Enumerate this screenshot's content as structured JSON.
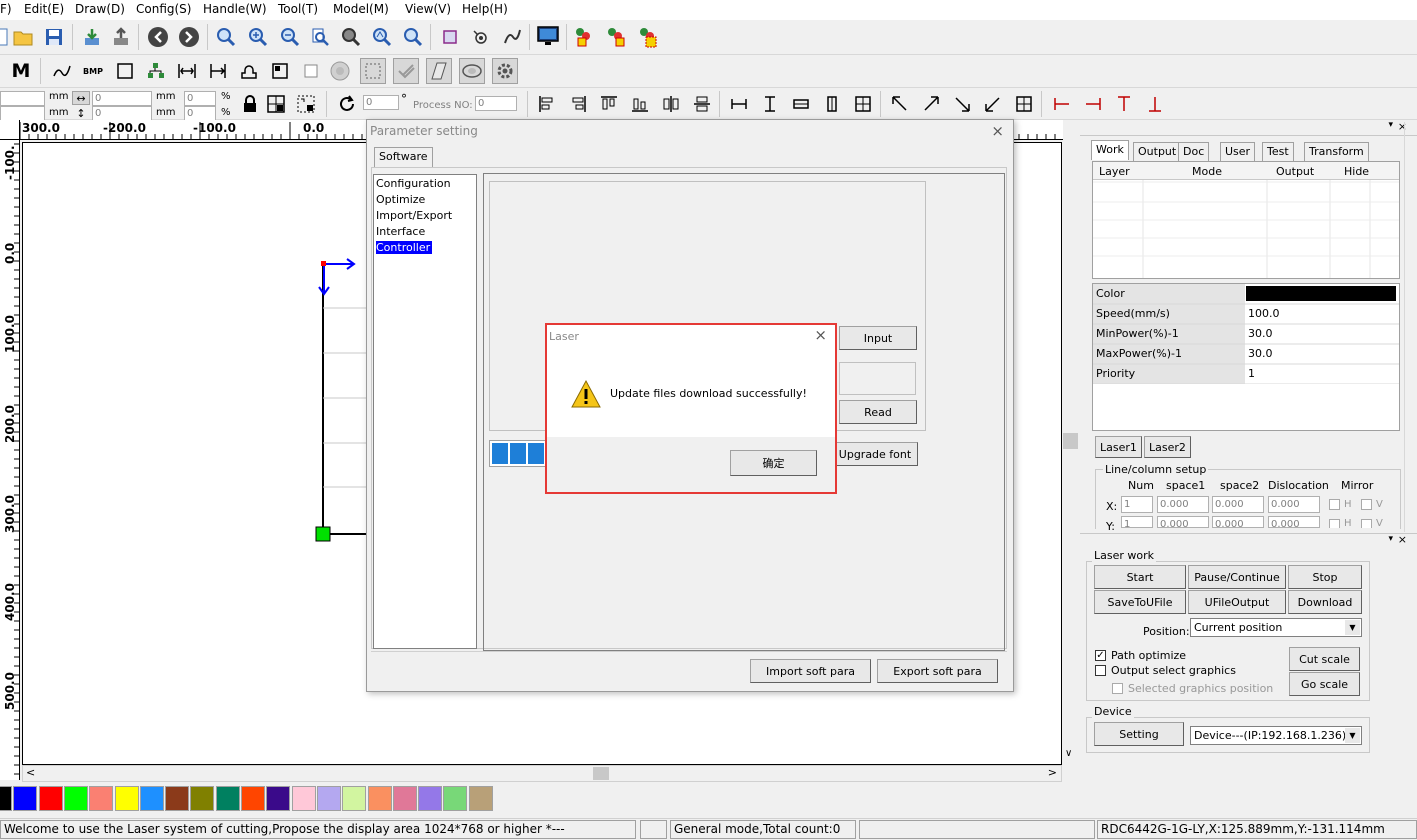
{
  "menu": [
    "F)",
    "Edit(E)",
    "Draw(D)",
    "Config(S)",
    "Handle(W)",
    "Tool(T)",
    "Model(M)",
    "View(V)",
    "Help(H)"
  ],
  "toolbar3": {
    "unit_mm": "mm",
    "unit_pct": "%",
    "x_value": "0",
    "y_value": "0",
    "w_value": "0",
    "h_value": "0",
    "pw_value": "0",
    "ph_value": "0",
    "rotate_value": "0",
    "rotate_unit": "°",
    "process_label": "Process NO:",
    "process_value": "0"
  },
  "ruler": {
    "h_labels": [
      "300.0",
      "-200.0",
      "-100.0",
      "0.0"
    ],
    "v_labels": [
      "-100.",
      "0.0",
      "100.0",
      "200.0",
      "300.0",
      "400.0",
      "500.0"
    ]
  },
  "palette": [
    "#000000",
    "#0000ff",
    "#ff0000",
    "#00ff00",
    "#fa8072",
    "#ffff00",
    "#1e90ff",
    "#8b3a1a",
    "#808000",
    "#008060",
    "#ff4500",
    "#3a0a8a",
    "#ffc8d8",
    "#b4a8f0",
    "#d2f5a0",
    "#fa9060",
    "#e07898",
    "#9478e8",
    "#78d878",
    "#b8a078"
  ],
  "status": {
    "welcome": "Welcome to use the Laser system of cutting,Propose the display area 1024*768 or higher *---",
    "mode": "General mode,Total count:0",
    "position": "RDC6442G-1G-LY,X:125.889mm,Y:-131.114mm"
  },
  "right_panel": {
    "tabs": [
      "Work",
      "Output",
      "Doc",
      "User",
      "Test",
      "Transform"
    ],
    "layer_headers": [
      "Layer",
      "Mode",
      "Output",
      "Hide"
    ],
    "props": [
      {
        "label": "Color",
        "value": ""
      },
      {
        "label": "Speed(mm/s)",
        "value": "100.0"
      },
      {
        "label": "MinPower(%)-1",
        "value": "30.0"
      },
      {
        "label": "MaxPower(%)-1",
        "value": "30.0"
      },
      {
        "label": "Priority",
        "value": "1"
      }
    ],
    "color_swatch": "#000000",
    "laser_tabs": [
      "Laser1",
      "Laser2"
    ],
    "line_column": {
      "title": "Line/column setup",
      "headers": [
        "Num",
        "space1",
        "space2",
        "Dislocation",
        "Mirror"
      ],
      "row_x": {
        "label": "X:",
        "num": "1",
        "space1": "0.000",
        "space2": "0.000",
        "dislocation": "0.000",
        "h": "H",
        "v": "V"
      },
      "row_y": {
        "label": "Y:",
        "num": "1",
        "space1": "0.000",
        "space2": "0.000",
        "dislocation": "0.000",
        "h": "H",
        "v": "V"
      }
    },
    "laser_work": {
      "title": "Laser work",
      "start": "Start",
      "pause": "Pause/Continue",
      "stop": "Stop",
      "save": "SaveToUFile",
      "ufile": "UFileOutput",
      "download": "Download",
      "position_label": "Position:",
      "position_value": "Current position",
      "path_optimize": "Path optimize",
      "output_select": "Output select graphics",
      "selected_pos": "Selected graphics position",
      "cut_scale": "Cut scale",
      "go_scale": "Go scale"
    },
    "device": {
      "title": "Device",
      "setting": "Setting",
      "value": "Device---(IP:192.168.1.236)"
    }
  },
  "param_dialog": {
    "title": "Parameter setting",
    "tab": "Software",
    "tree": [
      "Configuration",
      "Optimize",
      "Import/Export",
      "Interface",
      "Controller"
    ],
    "input_btn": "Input",
    "read_btn": "Read",
    "upgrade_btn": "Upgrade font",
    "import_btn": "Import soft para",
    "export_btn": "Export soft para"
  },
  "laser_dialog": {
    "title": "Laser",
    "message": "Update files download successfully!",
    "ok": "确定"
  }
}
